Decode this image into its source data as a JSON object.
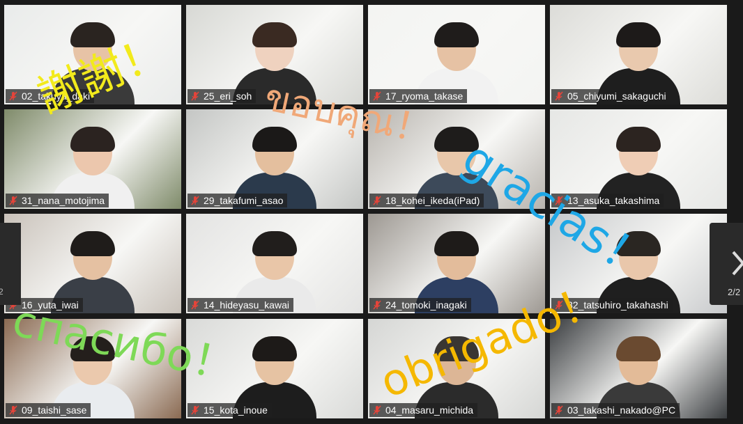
{
  "participants": [
    {
      "name": "02_takuya_daki"
    },
    {
      "name": "25_eri_soh"
    },
    {
      "name": "17_ryoma_takase"
    },
    {
      "name": "05_chiyumi_sakaguchi"
    },
    {
      "name": "31_nana_motojima"
    },
    {
      "name": "29_takafumi_asao"
    },
    {
      "name": "18_kohei_ikeda(iPad)"
    },
    {
      "name": "13_asuka_takashima"
    },
    {
      "name": "16_yuta_iwai"
    },
    {
      "name": "14_hideyasu_kawai"
    },
    {
      "name": "24_tomoki_inagaki"
    },
    {
      "name": "32_tatsuhiro_takahashi"
    },
    {
      "name": "09_taishi_sase"
    },
    {
      "name": "15_kota_inoue"
    },
    {
      "name": "04_masaru_michida"
    },
    {
      "name": "03_takashi_nakado@PC"
    }
  ],
  "overlays": {
    "chinese": "謝謝！",
    "thai": "ขอบคุณ！",
    "spanish": "gracias！",
    "russian": "спасибо！",
    "portuguese": "obrigado！"
  },
  "pagination": {
    "page": "2/2",
    "prev_page": "2"
  },
  "colors": {
    "chinese": "#f2ea1c",
    "thai": "#f0a878",
    "spanish": "#1ea7e6",
    "russian": "#7ed957",
    "portuguese": "#f5b800",
    "muted_icon": "#e5443a"
  }
}
